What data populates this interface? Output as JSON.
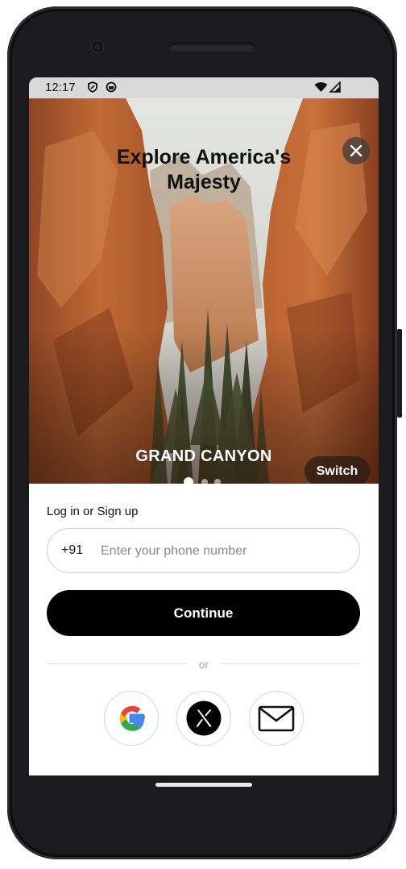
{
  "status_bar": {
    "time": "12:17",
    "icons": [
      "shield-icon",
      "sync-icon",
      "wifi-icon",
      "signal-icon"
    ]
  },
  "hero": {
    "title": "Explore America's Majesty",
    "destination": "GRAND CANYON",
    "switch_label": "Switch",
    "close_icon": "close-icon",
    "carousel": {
      "count": 3,
      "active_index": 0
    }
  },
  "login": {
    "label": "Log in or Sign up",
    "country_code": "+91",
    "phone_placeholder": "Enter your phone number",
    "phone_value": "",
    "continue_label": "Continue",
    "divider_text": "or"
  },
  "social": [
    {
      "name": "google-icon"
    },
    {
      "name": "x-icon"
    },
    {
      "name": "mail-icon"
    }
  ],
  "colors": {
    "primary": "#000000",
    "on_primary": "#ffffff",
    "border": "#cfcfcf",
    "muted_text": "#8a8a8a"
  }
}
